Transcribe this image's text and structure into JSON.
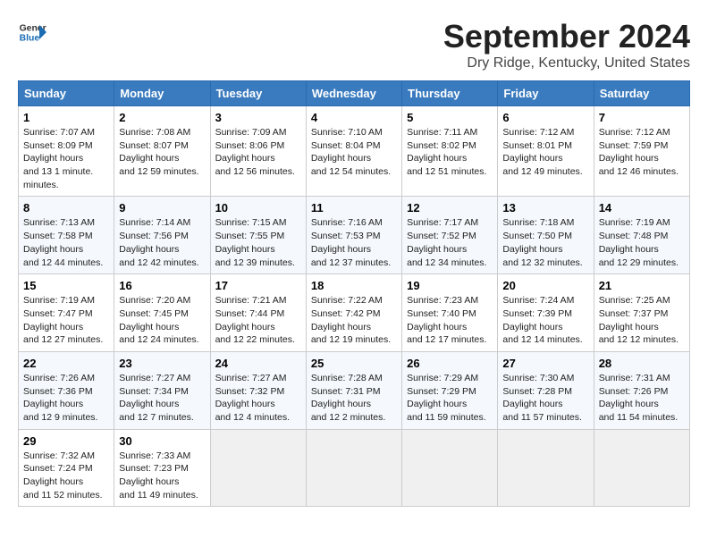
{
  "logo": {
    "line1": "General",
    "line2": "Blue",
    "icon_color": "#1a6db5"
  },
  "title": "September 2024",
  "location": "Dry Ridge, Kentucky, United States",
  "headers": [
    "Sunday",
    "Monday",
    "Tuesday",
    "Wednesday",
    "Thursday",
    "Friday",
    "Saturday"
  ],
  "weeks": [
    [
      {
        "day": "1",
        "sunrise": "7:07 AM",
        "sunset": "8:09 PM",
        "daylight": "13 hours and 1 minute."
      },
      {
        "day": "2",
        "sunrise": "7:08 AM",
        "sunset": "8:07 PM",
        "daylight": "12 hours and 59 minutes."
      },
      {
        "day": "3",
        "sunrise": "7:09 AM",
        "sunset": "8:06 PM",
        "daylight": "12 hours and 56 minutes."
      },
      {
        "day": "4",
        "sunrise": "7:10 AM",
        "sunset": "8:04 PM",
        "daylight": "12 hours and 54 minutes."
      },
      {
        "day": "5",
        "sunrise": "7:11 AM",
        "sunset": "8:02 PM",
        "daylight": "12 hours and 51 minutes."
      },
      {
        "day": "6",
        "sunrise": "7:12 AM",
        "sunset": "8:01 PM",
        "daylight": "12 hours and 49 minutes."
      },
      {
        "day": "7",
        "sunrise": "7:12 AM",
        "sunset": "7:59 PM",
        "daylight": "12 hours and 46 minutes."
      }
    ],
    [
      {
        "day": "8",
        "sunrise": "7:13 AM",
        "sunset": "7:58 PM",
        "daylight": "12 hours and 44 minutes."
      },
      {
        "day": "9",
        "sunrise": "7:14 AM",
        "sunset": "7:56 PM",
        "daylight": "12 hours and 42 minutes."
      },
      {
        "day": "10",
        "sunrise": "7:15 AM",
        "sunset": "7:55 PM",
        "daylight": "12 hours and 39 minutes."
      },
      {
        "day": "11",
        "sunrise": "7:16 AM",
        "sunset": "7:53 PM",
        "daylight": "12 hours and 37 minutes."
      },
      {
        "day": "12",
        "sunrise": "7:17 AM",
        "sunset": "7:52 PM",
        "daylight": "12 hours and 34 minutes."
      },
      {
        "day": "13",
        "sunrise": "7:18 AM",
        "sunset": "7:50 PM",
        "daylight": "12 hours and 32 minutes."
      },
      {
        "day": "14",
        "sunrise": "7:19 AM",
        "sunset": "7:48 PM",
        "daylight": "12 hours and 29 minutes."
      }
    ],
    [
      {
        "day": "15",
        "sunrise": "7:19 AM",
        "sunset": "7:47 PM",
        "daylight": "12 hours and 27 minutes."
      },
      {
        "day": "16",
        "sunrise": "7:20 AM",
        "sunset": "7:45 PM",
        "daylight": "12 hours and 24 minutes."
      },
      {
        "day": "17",
        "sunrise": "7:21 AM",
        "sunset": "7:44 PM",
        "daylight": "12 hours and 22 minutes."
      },
      {
        "day": "18",
        "sunrise": "7:22 AM",
        "sunset": "7:42 PM",
        "daylight": "12 hours and 19 minutes."
      },
      {
        "day": "19",
        "sunrise": "7:23 AM",
        "sunset": "7:40 PM",
        "daylight": "12 hours and 17 minutes."
      },
      {
        "day": "20",
        "sunrise": "7:24 AM",
        "sunset": "7:39 PM",
        "daylight": "12 hours and 14 minutes."
      },
      {
        "day": "21",
        "sunrise": "7:25 AM",
        "sunset": "7:37 PM",
        "daylight": "12 hours and 12 minutes."
      }
    ],
    [
      {
        "day": "22",
        "sunrise": "7:26 AM",
        "sunset": "7:36 PM",
        "daylight": "12 hours and 9 minutes."
      },
      {
        "day": "23",
        "sunrise": "7:27 AM",
        "sunset": "7:34 PM",
        "daylight": "12 hours and 7 minutes."
      },
      {
        "day": "24",
        "sunrise": "7:27 AM",
        "sunset": "7:32 PM",
        "daylight": "12 hours and 4 minutes."
      },
      {
        "day": "25",
        "sunrise": "7:28 AM",
        "sunset": "7:31 PM",
        "daylight": "12 hours and 2 minutes."
      },
      {
        "day": "26",
        "sunrise": "7:29 AM",
        "sunset": "7:29 PM",
        "daylight": "11 hours and 59 minutes."
      },
      {
        "day": "27",
        "sunrise": "7:30 AM",
        "sunset": "7:28 PM",
        "daylight": "11 hours and 57 minutes."
      },
      {
        "day": "28",
        "sunrise": "7:31 AM",
        "sunset": "7:26 PM",
        "daylight": "11 hours and 54 minutes."
      }
    ],
    [
      {
        "day": "29",
        "sunrise": "7:32 AM",
        "sunset": "7:24 PM",
        "daylight": "11 hours and 52 minutes."
      },
      {
        "day": "30",
        "sunrise": "7:33 AM",
        "sunset": "7:23 PM",
        "daylight": "11 hours and 49 minutes."
      },
      null,
      null,
      null,
      null,
      null
    ]
  ]
}
